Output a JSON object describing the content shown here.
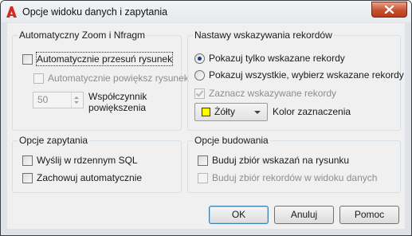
{
  "window": {
    "title": "Opcje widoku danych i zapytania"
  },
  "zoom_group": {
    "title": "Automatyczny Zoom i Nfragm",
    "auto_pan_label": "Automatycznie przesuń rysunek",
    "auto_zoom_label": "Automatycznie powiększ rysunek",
    "zoom_factor_value": "50",
    "zoom_factor_label_line1": "Współczynnik",
    "zoom_factor_label_line2": "powiększenia"
  },
  "record_group": {
    "title": "Nastawy wskazywania rekordów",
    "show_only_selected_label": "Pokazuj tylko wskazane rekordy",
    "show_all_label": "Pokazuj wszystkie, wybierz wskazane rekordy",
    "mark_selected_label": "Zaznacz wskazywane rekordy",
    "color_value": "Żółty",
    "color_label": "Kolor zaznaczenia"
  },
  "query_group": {
    "title": "Opcje zapytania",
    "native_sql_label": "Wyślij w rdzennym SQL",
    "auto_store_label": "Zachowuj automatycznie"
  },
  "build_group": {
    "title": "Opcje budowania",
    "build_on_drawing_label": "Buduj zbiór wskazań na rysunku",
    "build_in_view_label": "Buduj zbiór rekordów w widoku danych"
  },
  "buttons": {
    "ok": "OK",
    "cancel": "Anuluj",
    "help": "Pomoc"
  },
  "colors": {
    "selection_color": "#ffff00",
    "app_icon": "#d42a1e"
  }
}
